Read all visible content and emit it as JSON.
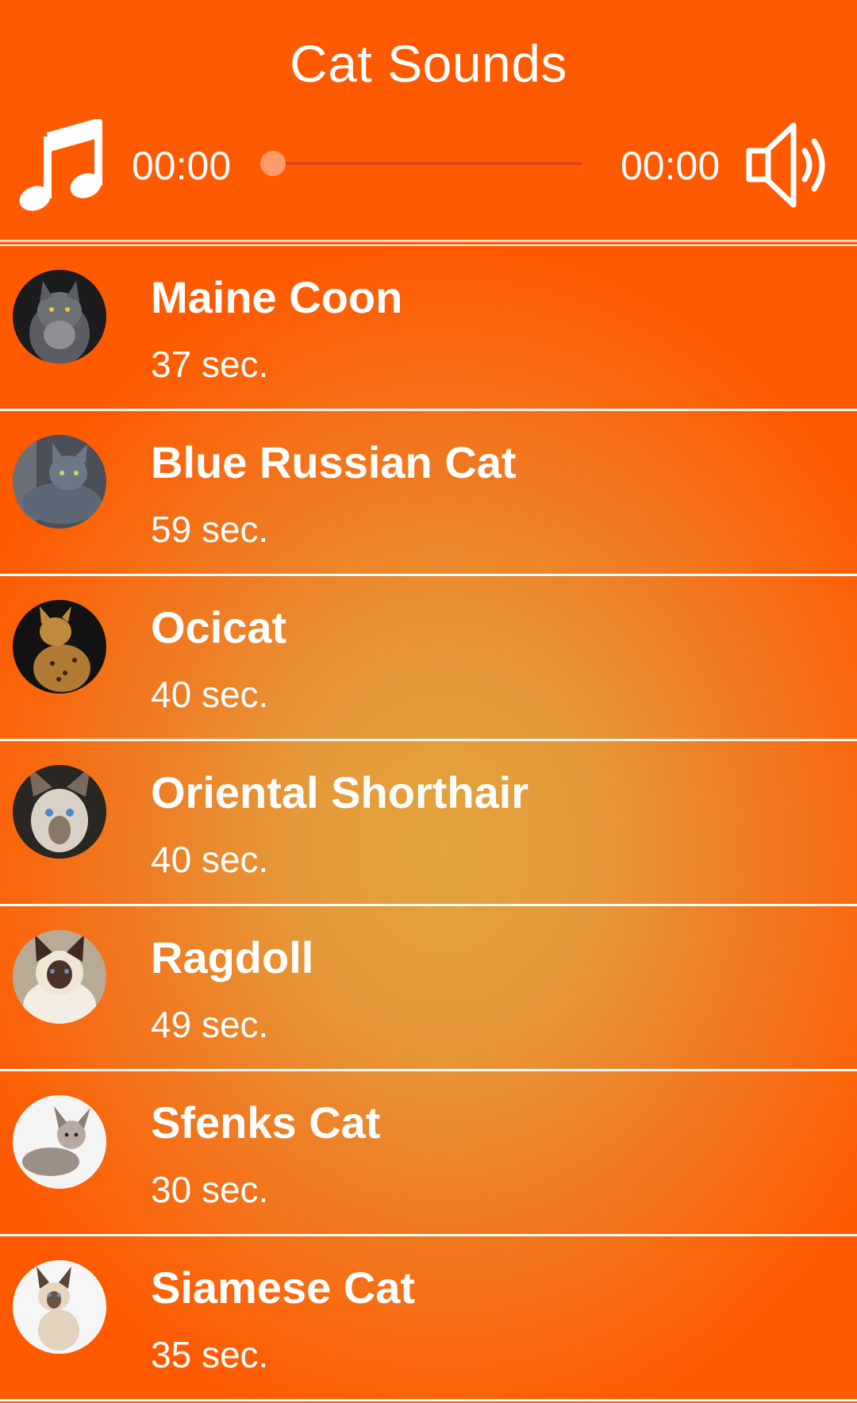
{
  "header": {
    "title": "Cat Sounds",
    "current_time": "00:00",
    "total_time": "00:00",
    "progress": 0,
    "music_icon": "music-note-icon",
    "volume_icon": "volume-icon"
  },
  "colors": {
    "header_bg": "#ff5a00",
    "list_center": "#e2a33b",
    "list_edge": "#ff5a00",
    "text": "#ffffff"
  },
  "cats": [
    {
      "name": "Maine Coon",
      "duration": "37 sec."
    },
    {
      "name": "Blue Russian Cat",
      "duration": "59 sec."
    },
    {
      "name": "Ocicat",
      "duration": "40 sec."
    },
    {
      "name": "Oriental Shorthair",
      "duration": "40 sec."
    },
    {
      "name": "Ragdoll",
      "duration": "49 sec."
    },
    {
      "name": "Sfenks Cat",
      "duration": "30 sec."
    },
    {
      "name": "Siamese Cat",
      "duration": "35 sec."
    }
  ]
}
